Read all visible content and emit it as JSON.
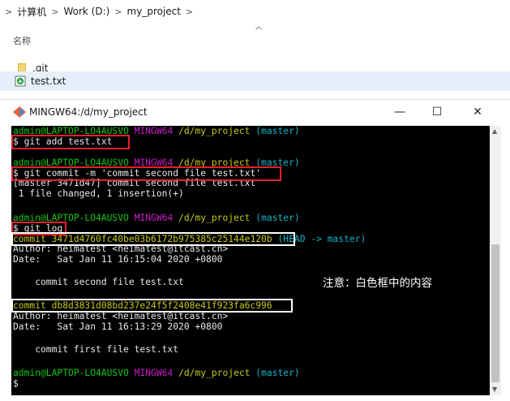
{
  "explorer": {
    "breadcrumb": {
      "lead_arrow": ">",
      "items": [
        "计算机",
        "Work (D:)",
        "my_project"
      ],
      "separators": [
        ">",
        ">",
        ">"
      ]
    },
    "column_header": {
      "name": "名称",
      "sort_icon": "chevron-up-icon"
    },
    "files": [
      {
        "name": ".git",
        "icon": "folder-icon"
      },
      {
        "name": "test.txt",
        "icon": "text-file-icon",
        "selected": true
      }
    ]
  },
  "terminal_window": {
    "title": "MINGW64:/d/my_project",
    "controls": {
      "minimize": "—",
      "maximize": "☐",
      "close": "✕"
    },
    "prompt": {
      "user_host": "admin@LAPTOP-LO4AUSVO",
      "shell": "MINGW64",
      "path": "/d/my_project",
      "branch": "(master)"
    },
    "lines": {
      "cmd1": "$ git add test.txt",
      "cmd2": "$ git commit -m 'commit second file test.txt'",
      "out2a": "[master 3471d47] commit second file test.txt",
      "out2b": " 1 file changed, 1 insertion(+)",
      "cmd3": "$ git log",
      "commit1": "commit 3471d4760fc40be03b6172b975385c25144e120b",
      "commit1_ref": "(HEAD -> master)",
      "author1": "Author: heimatest <heimatest@itcast.cn>",
      "date1": "Date:   Sat Jan 11 16:15:04 2020 +0800",
      "msg1": "    commit second file test.txt",
      "commit2": "commit db8d3831d08bd237e24f5f2408e41f923fa6c996",
      "author2": "Author: heimatest <heimatest@itcast.cn>",
      "date2": "Date:   Sat Jan 11 16:13:29 2020 +0800",
      "msg2": "    commit first file test.txt",
      "final_prompt": "$"
    },
    "annotation": "注意：白色框中的内容",
    "colors": {
      "background": "#000000",
      "user_host": "#14c814",
      "shell": "#c81ec8",
      "path": "#c8c814",
      "branch": "#14b4c8",
      "red_box": "#e8202a",
      "white_box": "#ffffff"
    }
  }
}
